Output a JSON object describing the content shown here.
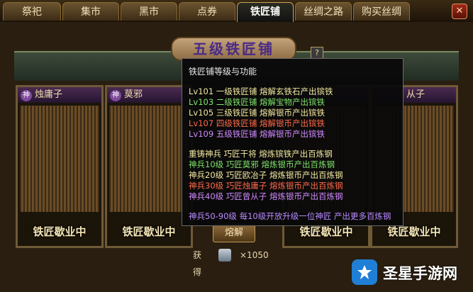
{
  "tabs": [
    {
      "label": "祭祀"
    },
    {
      "label": "集市"
    },
    {
      "label": "黑市"
    },
    {
      "label": "点券"
    },
    {
      "label": "铁匠铺"
    },
    {
      "label": "丝绸之路"
    },
    {
      "label": "购买丝绸"
    }
  ],
  "active_tab": "铁匠铺",
  "sign": {
    "title": "五级铁匠铺"
  },
  "help_button": "?",
  "panels": [
    {
      "name": "烛庸子",
      "status": "铁匠歇业中"
    },
    {
      "name": "莫邪",
      "status": "铁匠歇业中"
    },
    {
      "name": "",
      "status": "铁匠歇业中"
    },
    {
      "name": "从子",
      "status": "铁匠歇业中"
    }
  ],
  "tooltip": {
    "title": "铁匠铺等级与功能",
    "levels": [
      {
        "text": "Lv101  一级铁匠铺  熔解玄铁石产出镔铁",
        "color": "#f2e9a0"
      },
      {
        "text": "Lv103  二级铁匠铺  熔解宝物产出镔铁",
        "color": "#7fe36a"
      },
      {
        "text": "Lv105  三级铁匠铺  熔解银币产出镔铁",
        "color": "#f2e9a0"
      },
      {
        "text": "Lv107  四级铁匠铺  熔解银币产出镔铁",
        "color": "#ff6a4a"
      },
      {
        "text": "Lv109  五级铁匠铺  熔解银币产出镔铁",
        "color": "#d08aff"
      }
    ],
    "recast": [
      {
        "text": "重铸神兵  巧匠干将    熔炼镔铁产出百炼钢",
        "color": "#f2e9a0"
      },
      {
        "text": "神兵10级  巧匠莫邪    熔炼银币产出百炼钢",
        "color": "#7fe36a"
      },
      {
        "text": "神兵20级  巧匠欧冶子  熔炼银币产出百炼钢",
        "color": "#f2e9a0"
      },
      {
        "text": "神兵30级  巧匠烛庸子  熔炼银币产出百炼钢",
        "color": "#ff6a4a"
      },
      {
        "text": "神兵40级  巧匠曾从子  熔炼银币产出百炼钢",
        "color": "#d08aff"
      }
    ],
    "note": {
      "text": "神兵50-90级  每10级开放升级一位神匠  产出更多百炼钢",
      "color": "#b98aff"
    }
  },
  "melt_button": "熔解",
  "gain": {
    "label": "获得",
    "item_icon": "ingot-icon",
    "quantity": "×1050"
  },
  "watermark": {
    "text": "圣星手游网"
  }
}
